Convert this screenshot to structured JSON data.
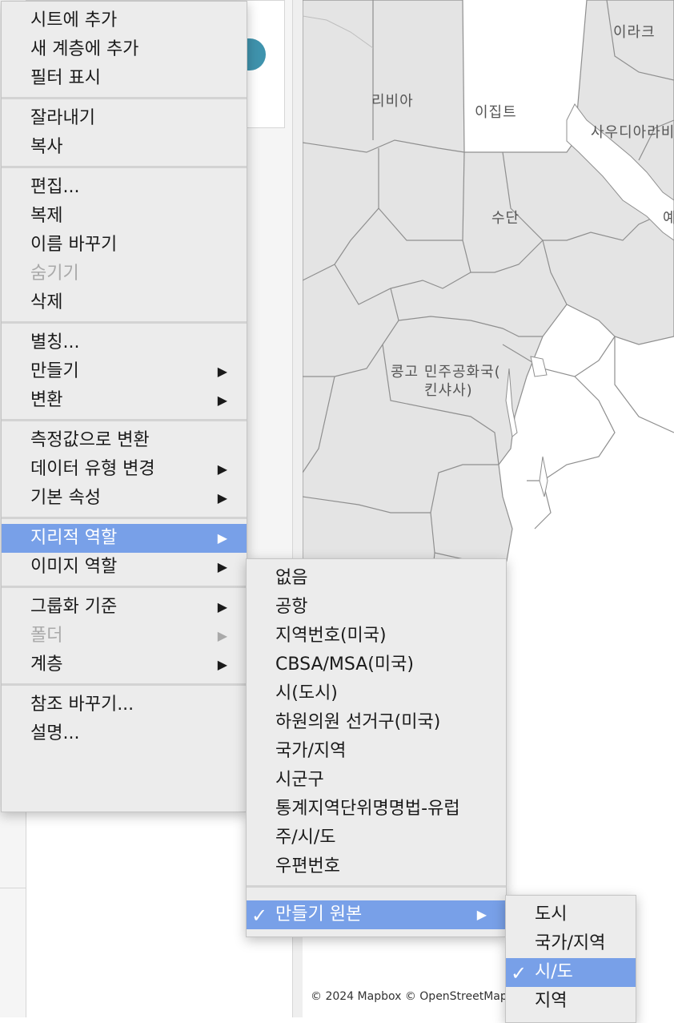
{
  "map": {
    "labels": {
      "iraq": "이라크",
      "libya": "리비아",
      "egypt": "이집트",
      "saudi": "사우디아라비",
      "sudan": "수단",
      "yemen": "예",
      "drc_line1": "콩고 민주공화국(",
      "drc_line2": "킨샤사)"
    },
    "attribution": "© 2024 Mapbox © OpenStreetMap"
  },
  "context_menu": {
    "groups": [
      [
        {
          "label": "시트에 추가"
        },
        {
          "label": "새 계층에 추가"
        },
        {
          "label": "필터 표시"
        }
      ],
      [
        {
          "label": "잘라내기"
        },
        {
          "label": "복사"
        }
      ],
      [
        {
          "label": "편집..."
        },
        {
          "label": "복제"
        },
        {
          "label": "이름 바꾸기"
        },
        {
          "label": "숨기기",
          "disabled": true
        },
        {
          "label": "삭제"
        }
      ],
      [
        {
          "label": "별칭..."
        },
        {
          "label": "만들기",
          "submenu": true
        },
        {
          "label": "변환",
          "submenu": true
        }
      ],
      [
        {
          "label": "측정값으로 변환"
        },
        {
          "label": "데이터 유형 변경",
          "submenu": true
        },
        {
          "label": "기본 속성",
          "submenu": true
        }
      ],
      [
        {
          "label": "지리적 역할",
          "submenu": true,
          "highlighted": true
        },
        {
          "label": "이미지 역할",
          "submenu": true
        }
      ],
      [
        {
          "label": "그룹화 기준",
          "submenu": true
        },
        {
          "label": "폴더",
          "submenu": true,
          "disabled": true
        },
        {
          "label": "계층",
          "submenu": true
        }
      ],
      [
        {
          "label": "참조 바꾸기..."
        },
        {
          "label": "설명..."
        }
      ]
    ]
  },
  "geo_role_menu": {
    "items": [
      {
        "label": "없음"
      },
      {
        "label": "공항"
      },
      {
        "label": "지역번호(미국)"
      },
      {
        "label": "CBSA/MSA(미국)"
      },
      {
        "label": "시(도시)"
      },
      {
        "label": "하원의원 선거구(미국)"
      },
      {
        "label": "국가/지역"
      },
      {
        "label": "시군구"
      },
      {
        "label": "통계지역단위명명법-유럽"
      },
      {
        "label": "주/시/도"
      },
      {
        "label": "우편번호"
      }
    ],
    "created_from": {
      "label": "만들기 원본",
      "checked": true,
      "submenu": true,
      "highlighted": true
    }
  },
  "created_from_menu": {
    "items": [
      {
        "label": "도시"
      },
      {
        "label": "국가/지역"
      },
      {
        "label": "시/도",
        "checked": true,
        "highlighted": true
      },
      {
        "label": "지역"
      }
    ]
  },
  "glyphs": {
    "arrow": "▶",
    "check": "✓"
  },
  "colors": {
    "highlight": "#78a0e8",
    "menu_bg": "#ececec",
    "toggle": "#3f93ad",
    "map_land": "#e4e4e4",
    "map_border": "#8f8f8f"
  }
}
